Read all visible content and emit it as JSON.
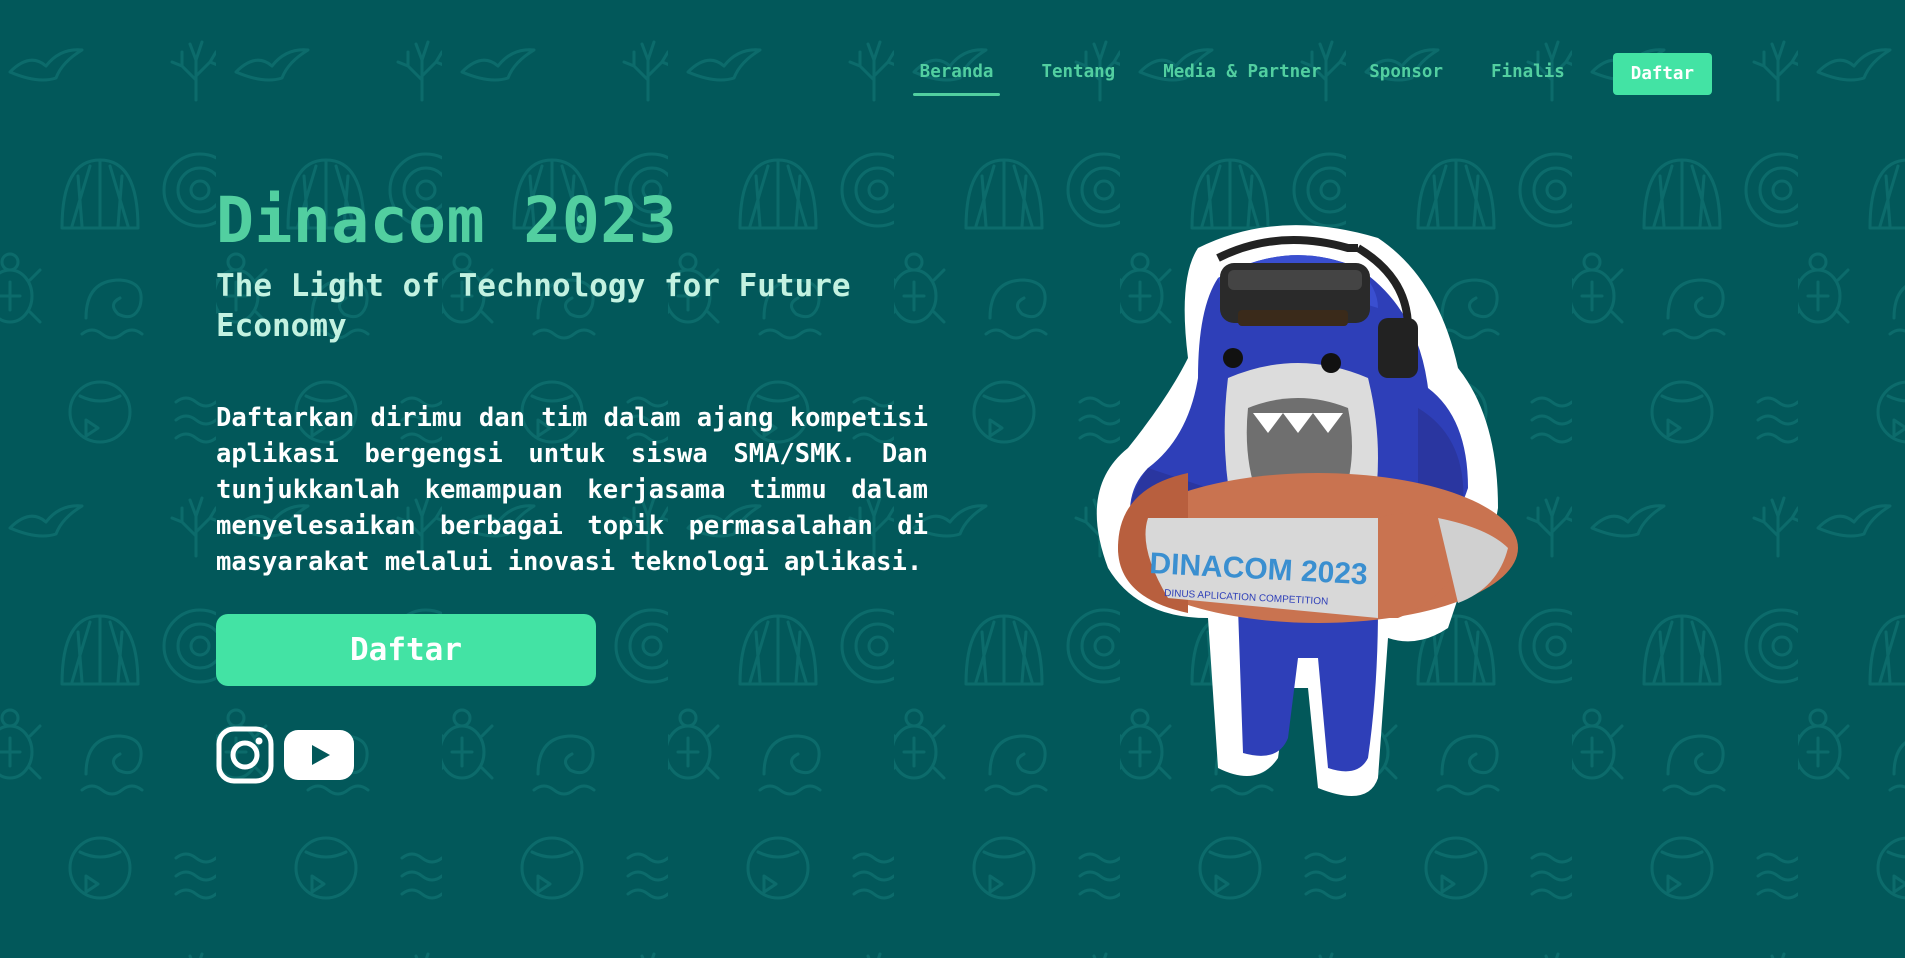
{
  "nav": {
    "items": [
      {
        "label": "Beranda",
        "active": true
      },
      {
        "label": "Tentang"
      },
      {
        "label": "Media & Partner"
      },
      {
        "label": "Sponsor"
      },
      {
        "label": "Finalis"
      }
    ],
    "cta_label": "Daftar"
  },
  "hero": {
    "title": "Dinacom 2023",
    "subtitle": "The Light of Technology for Future Economy",
    "description": "Daftarkan dirimu dan tim dalam ajang kompetisi aplikasi bergengsi untuk siswa SMA/SMK. Dan tunjukkanlah kemampuan kerjasama timmu dalam menyelesaikan berbagai topik permasalahan di masyarakat melalui inovasi teknologi aplikasi.",
    "cta_label": "Daftar"
  },
  "social": {
    "icons": [
      "instagram-icon",
      "youtube-icon"
    ]
  },
  "mascot": {
    "ring_text": "DINACOM 2023",
    "ring_subtext": "DINUS APLICATION COMPETITION"
  },
  "colors": {
    "background": "#02585a",
    "accent": "#43e3a4",
    "title": "#52cfa0",
    "subtitle": "#c3f2e1",
    "pattern": "#0c6b6b"
  }
}
